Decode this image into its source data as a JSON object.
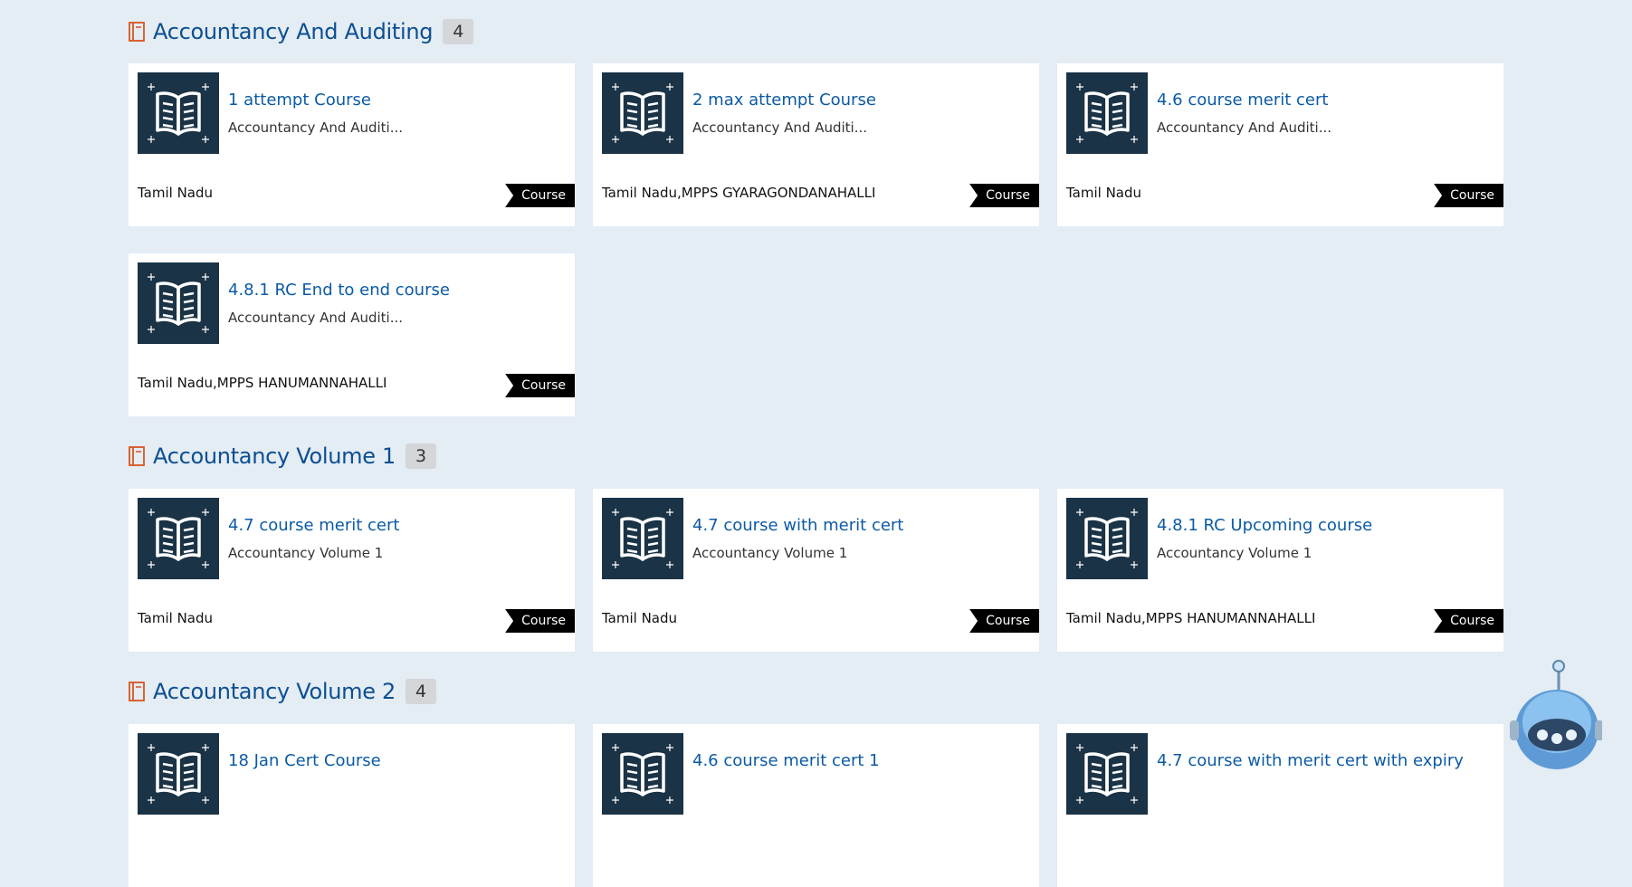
{
  "sections": [
    {
      "title": "Accountancy And Auditing",
      "count": "4",
      "cards": [
        {
          "title": "1 attempt Course",
          "subtitle": "Accountancy And Auditi...",
          "location": "Tamil Nadu",
          "tag": "Course"
        },
        {
          "title": "2 max attempt Course",
          "subtitle": "Accountancy And Auditi...",
          "location": "Tamil Nadu,MPPS GYARAGONDANAHALLI",
          "tag": "Course"
        },
        {
          "title": "4.6 course merit cert",
          "subtitle": "Accountancy And Auditi...",
          "location": "Tamil Nadu",
          "tag": "Course"
        },
        {
          "title": "4.8.1 RC End to end course",
          "subtitle": "Accountancy And Auditi...",
          "location": "Tamil Nadu,MPPS HANUMANNAHALLI",
          "tag": "Course"
        }
      ]
    },
    {
      "title": "Accountancy Volume 1",
      "count": "3",
      "cards": [
        {
          "title": "4.7 course merit cert",
          "subtitle": "Accountancy Volume 1",
          "location": "Tamil Nadu",
          "tag": "Course"
        },
        {
          "title": "4.7 course with merit cert",
          "subtitle": "Accountancy Volume 1",
          "location": "Tamil Nadu",
          "tag": "Course"
        },
        {
          "title": "4.8.1 RC Upcoming course",
          "subtitle": "Accountancy Volume 1",
          "location": "Tamil Nadu,MPPS HANUMANNAHALLI",
          "tag": "Course"
        }
      ]
    },
    {
      "title": "Accountancy Volume 2",
      "count": "4",
      "cards": [
        {
          "title": "18 Jan Cert Course"
        },
        {
          "title": "4.6 course merit cert 1"
        },
        {
          "title": "4.7 course with merit cert with expiry"
        }
      ]
    }
  ],
  "icons": {
    "section": "book-icon",
    "card_thumbnail": "open-book-icon",
    "assistant": "robot-assistant-icon"
  },
  "colors": {
    "page_background": "#e4ecf4",
    "title_blue": "#0b4f93",
    "card_title_blue": "#0b5aa6",
    "section_icon_orange": "#d9541e",
    "thumbnail_background": "#1a3346",
    "tag_background": "#000000",
    "count_badge": "#d4d6d9"
  }
}
